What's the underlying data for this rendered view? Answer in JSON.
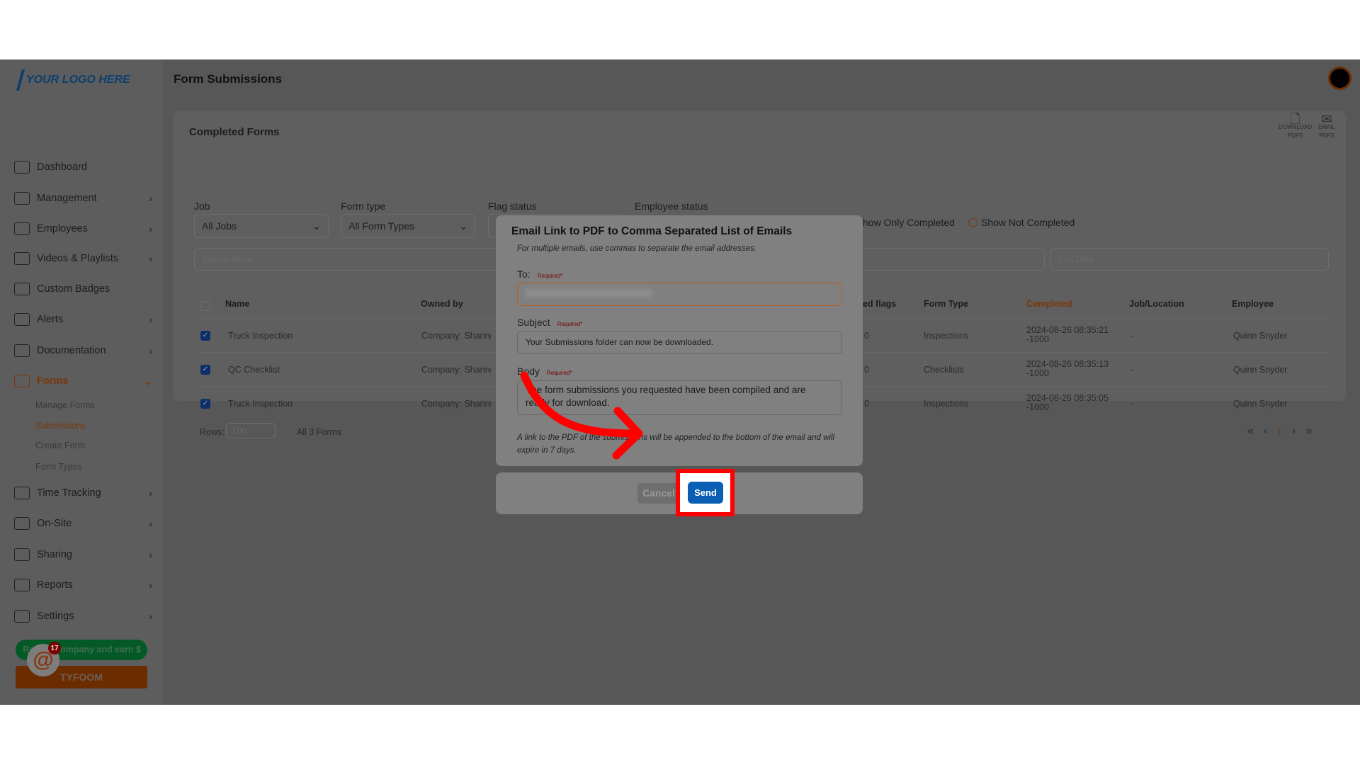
{
  "logo": "YOUR LOGO HERE",
  "header": {
    "title": "Form Submissions"
  },
  "sidebar": {
    "items": [
      {
        "label": "Dashboard",
        "icon": "dashboard-icon",
        "chevron": false
      },
      {
        "label": "Management",
        "icon": "management-icon",
        "chevron": true
      },
      {
        "label": "Employees",
        "icon": "user-icon",
        "chevron": true
      },
      {
        "label": "Videos & Playlists",
        "icon": "video-icon",
        "chevron": true
      },
      {
        "label": "Custom Badges",
        "icon": "badge-icon",
        "chevron": false
      },
      {
        "label": "Alerts",
        "icon": "chat-icon",
        "chevron": true
      },
      {
        "label": "Documentation",
        "icon": "document-icon",
        "chevron": true
      },
      {
        "label": "Forms",
        "icon": "forms-icon",
        "chevron": true,
        "active": true
      },
      {
        "label": "Time Tracking",
        "icon": "stopwatch-icon",
        "chevron": true
      },
      {
        "label": "On-Site",
        "icon": "location-icon",
        "chevron": true
      },
      {
        "label": "Sharing",
        "icon": "sharing-icon",
        "chevron": true
      },
      {
        "label": "Reports",
        "icon": "chart-icon",
        "chevron": true
      },
      {
        "label": "Settings",
        "icon": "gear-icon",
        "chevron": true
      }
    ],
    "forms_sub": [
      "Manage Forms",
      "Submissions",
      "Create Form",
      "Form Types"
    ],
    "promo": "Refer a company and earn $",
    "promo_visible": "ompany and earn $",
    "brand_button": "TYFOOM",
    "notif_count": "17"
  },
  "card": {
    "title": "Completed Forms",
    "filters": [
      {
        "label": "Job",
        "value": "All Jobs"
      },
      {
        "label": "Form type",
        "value": "All Form Types"
      },
      {
        "label": "Flag status",
        "value": ""
      },
      {
        "label": "Employee status",
        "value": ""
      }
    ],
    "radio_completed": "how Only Completed",
    "radio_not_completed": "Show Not Completed",
    "search_placeholder": "Search Name",
    "end_date_placeholder": "End Date",
    "toolbar": {
      "download": "DOWNLOAD",
      "download2": "PDFS",
      "email": "EMAIL",
      "email2": "PDFS"
    },
    "columns": [
      "Name",
      "Owned by",
      "ed flags",
      "Form Type",
      "Completed",
      "Job/Location",
      "Employee"
    ],
    "rows": [
      {
        "name": "Truck Inspection",
        "owner": "Company: Sharing",
        "flags": "0",
        "type": "Inspections",
        "completed": "2024-08-26 08:35:21",
        "tz": "-1000",
        "job": "-",
        "employee": "Quinn Snyder"
      },
      {
        "name": "QC Checklist",
        "owner": "Company: Sharing",
        "flags": "0",
        "type": "Checklists",
        "completed": "2024-08-26 08:35:13",
        "tz": "-1000",
        "job": "-",
        "employee": "Quinn Snyder"
      },
      {
        "name": "Truck Inspection",
        "owner": "Company: Sharing",
        "flags": "0",
        "type": "Inspections",
        "completed": "2024-08-26 08:35:05",
        "tz": "-1000",
        "job": "-",
        "employee": "Quinn Snyder"
      }
    ],
    "rows_label": "Rows:",
    "rows_value": "100",
    "count": "All 3 Forms",
    "page": "1"
  },
  "modal": {
    "title": "Email Link to PDF to Comma Separated List of Emails",
    "subtitle": "For multiple emails, use commas to separate the email addresses.",
    "to_label": "To:",
    "required": "Required*",
    "subject_label": "Subject",
    "subject_value": "Your Submissions folder can now be downloaded.",
    "body_label": "Body",
    "body_value": "The form submissions you requested have been compiled and are ready for download.",
    "note": "A link to the PDF of the submissions will be appended to the bottom of the email and will expire in 7 days.",
    "cancel": "Cancel",
    "send": "Send"
  },
  "colors": {
    "accent": "#e06a1b",
    "send": "#0a5fb4",
    "highlight": "#ff0000"
  }
}
